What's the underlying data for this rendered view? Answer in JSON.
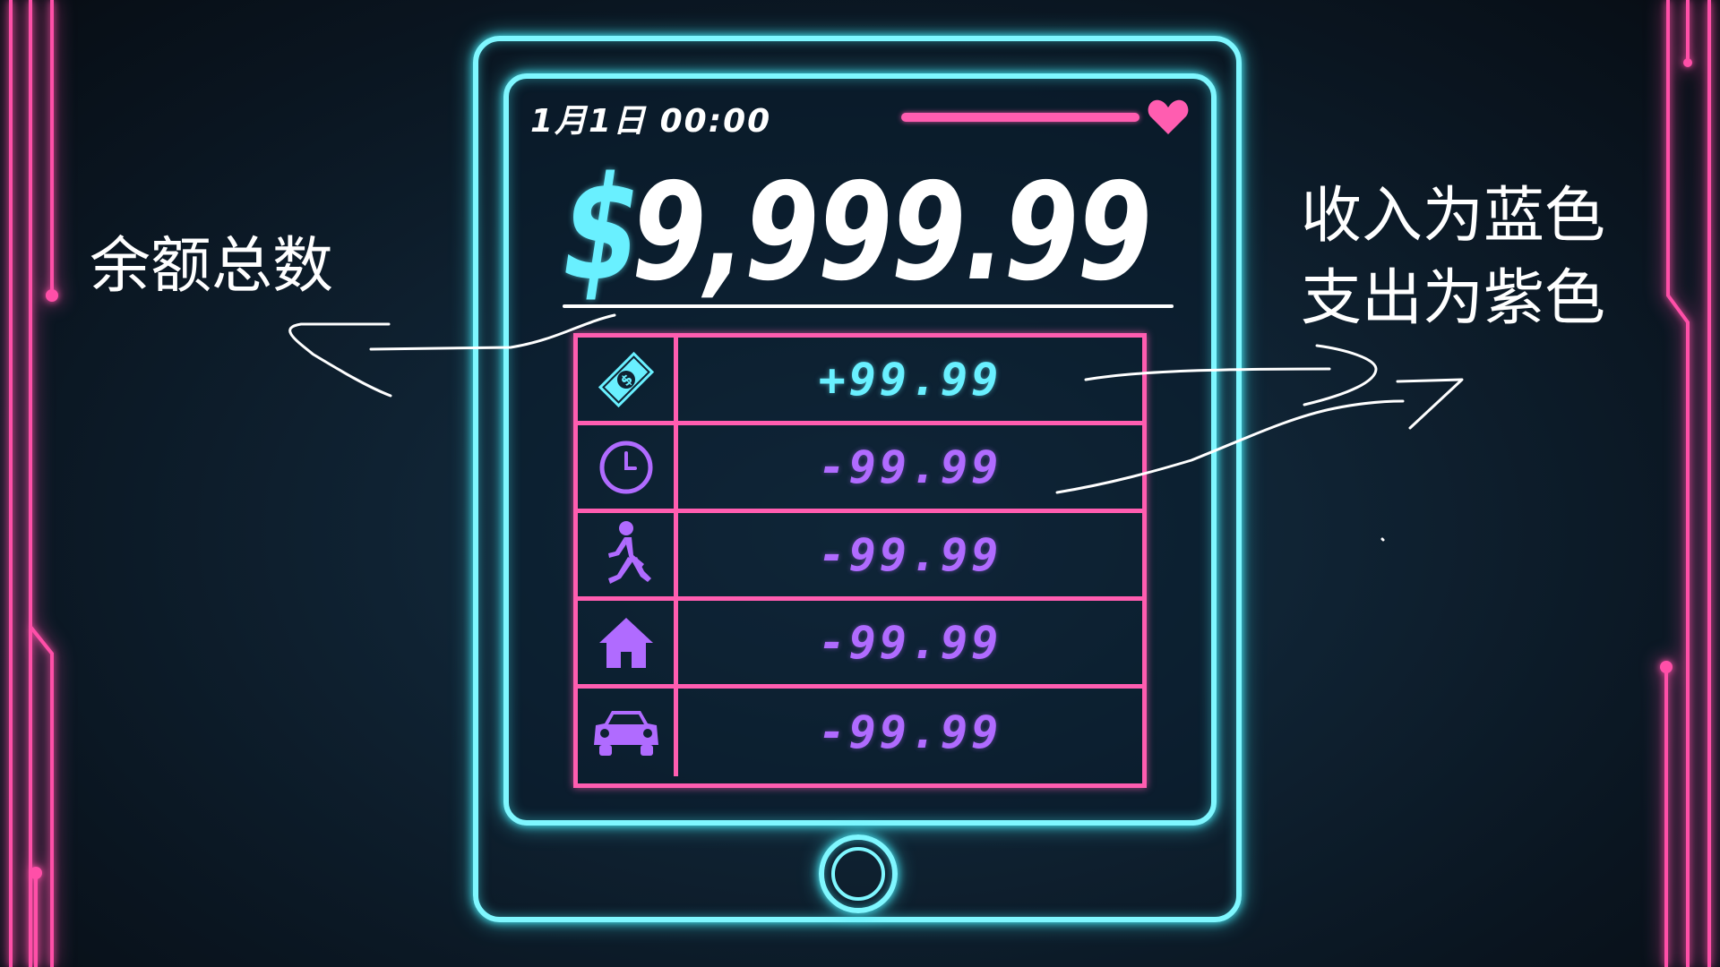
{
  "header": {
    "datetime": "1月1日 00:00"
  },
  "status": {
    "health_fraction": 1.0,
    "colors": {
      "accent": "#7ff7ff",
      "health": "#ff5db0"
    }
  },
  "balance": {
    "currency_symbol": "$",
    "amount": "9,999.99"
  },
  "transactions": [
    {
      "icon": "money-icon",
      "amount": "+99.99",
      "type": "income"
    },
    {
      "icon": "clock-icon",
      "amount": "-99.99",
      "type": "expense"
    },
    {
      "icon": "walking-person-icon",
      "amount": "-99.99",
      "type": "expense"
    },
    {
      "icon": "house-icon",
      "amount": "-99.99",
      "type": "expense"
    },
    {
      "icon": "car-icon",
      "amount": "-99.99",
      "type": "expense"
    }
  ],
  "colors": {
    "income": "#69f0ff",
    "expense": "#b06bff",
    "table_border": "#ff5db0",
    "background": "#0f2232"
  },
  "annotations": {
    "balance_label": "余额总数",
    "legend_line1": "收入为蓝色",
    "legend_line2": "支出为紫色"
  }
}
